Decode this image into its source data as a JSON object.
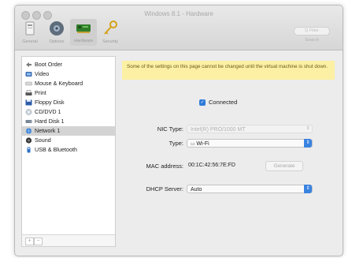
{
  "window": {
    "title": "Windows 8.1 - Hardware"
  },
  "toolbar": {
    "items": [
      {
        "label": "General",
        "icon": "general-icon"
      },
      {
        "label": "Options",
        "icon": "options-icon"
      },
      {
        "label": "Hardware",
        "icon": "hardware-icon"
      },
      {
        "label": "Security",
        "icon": "security-icon"
      }
    ],
    "search_label": "Search",
    "search_placeholder": "Q Filter"
  },
  "sidebar": {
    "items": [
      {
        "label": "Boot Order",
        "icon": "boot-order-icon"
      },
      {
        "label": "Video",
        "icon": "video-icon"
      },
      {
        "label": "Mouse & Keyboard",
        "icon": "mouse-keyboard-icon"
      },
      {
        "label": "Print",
        "icon": "printer-icon"
      },
      {
        "label": "Floppy Disk",
        "icon": "floppy-disk-icon"
      },
      {
        "label": "CD/DVD 1",
        "icon": "cd-dvd-icon"
      },
      {
        "label": "Hard Disk 1",
        "icon": "hard-disk-icon"
      },
      {
        "label": "Network 1",
        "icon": "network-icon",
        "selected": true
      },
      {
        "label": "Sound",
        "icon": "sound-icon"
      },
      {
        "label": "USB & Bluetooth",
        "icon": "usb-bluetooth-icon"
      }
    ],
    "add_label": "+",
    "remove_label": "−"
  },
  "main": {
    "banner": "Some of the settings on this page cannot be changed until the virtual machine is shut down.",
    "connected": {
      "label": "Connected",
      "checked": true
    },
    "nic_type": {
      "label": "NIC Type:",
      "value": "Intel(R) PRO/1000 MT",
      "disabled": true
    },
    "type": {
      "label": "Type:",
      "value": "Wi-Fi"
    },
    "mac": {
      "label": "MAC address:",
      "value": "00:1C:42:56:7E:FD",
      "button": "Generate"
    },
    "dhcp": {
      "label": "DHCP Server:",
      "value": "Auto"
    }
  },
  "colors": {
    "accent": "#3a83e0",
    "banner": "#fcf0a4",
    "selection": "#d4d4d4"
  }
}
